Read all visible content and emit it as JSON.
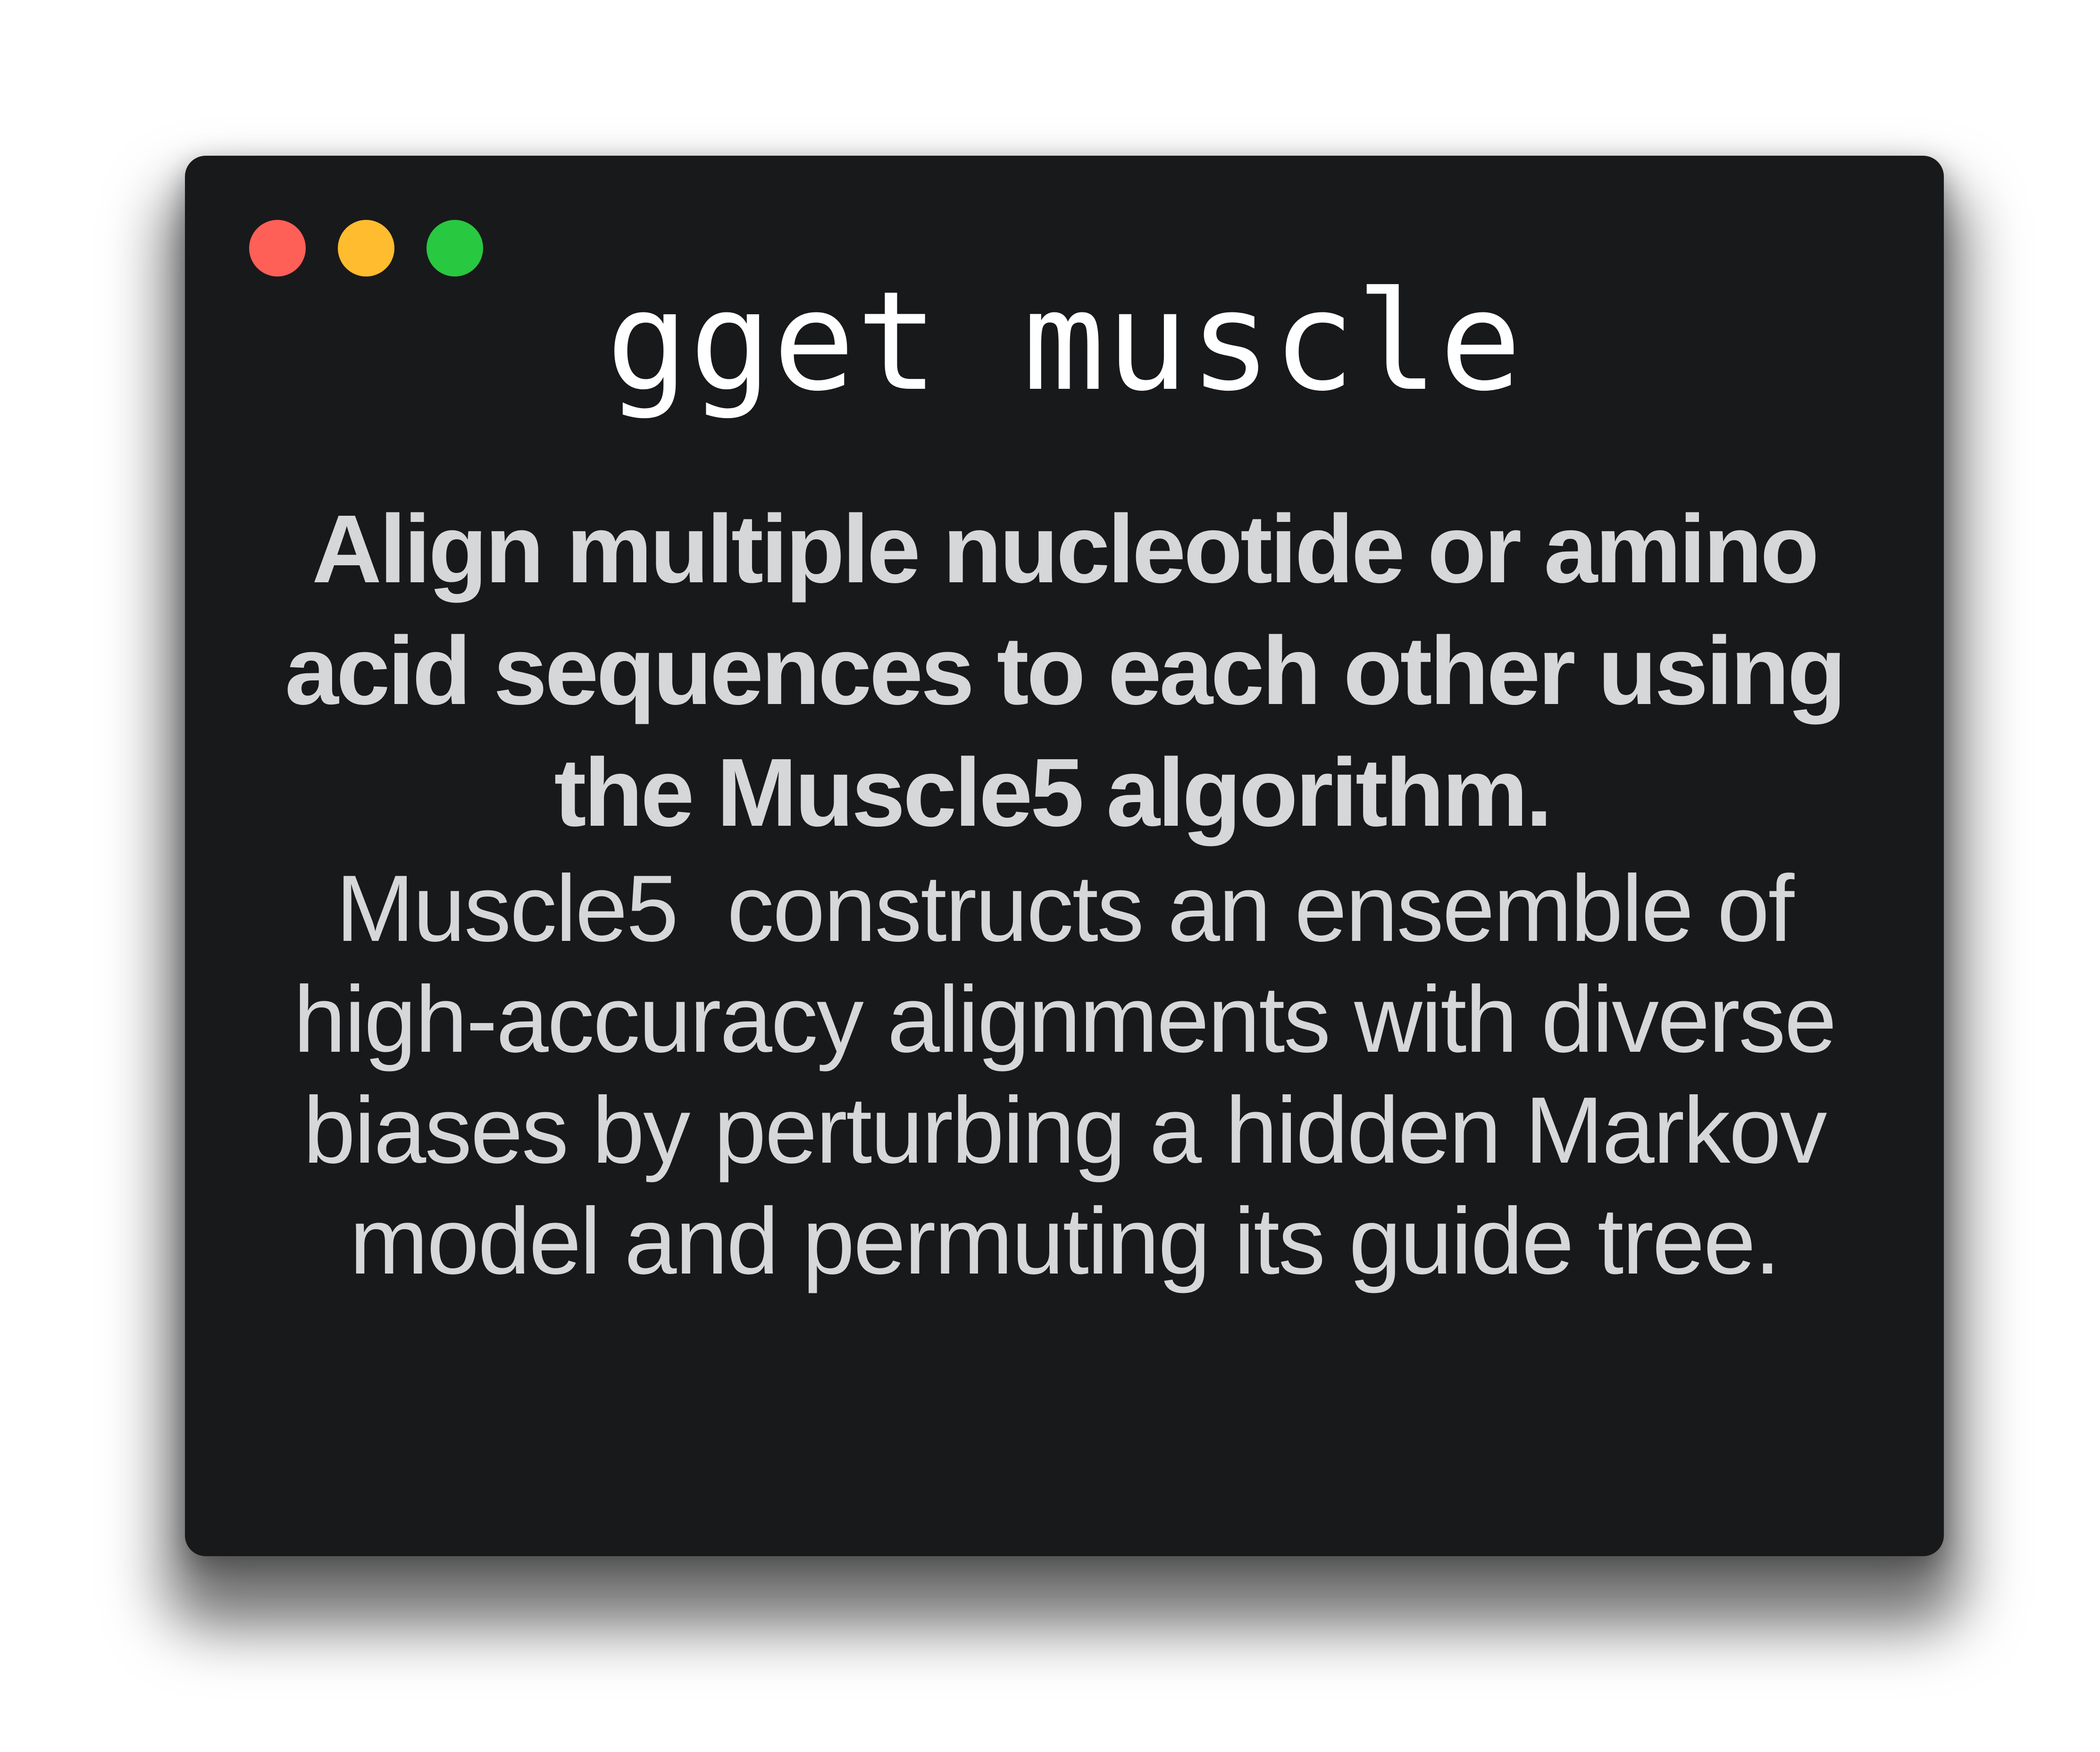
{
  "colors": {
    "window_background": "#18191b",
    "title_text": "#ffffff",
    "body_text": "#d6d7d9",
    "close": "#fe5f57",
    "minimize": "#febc2e",
    "maximize": "#28c840"
  },
  "window_controls": [
    {
      "name": "close",
      "icon": "close-dot-icon"
    },
    {
      "name": "minimize",
      "icon": "minimize-dot-icon"
    },
    {
      "name": "maximize",
      "icon": "maximize-dot-icon"
    }
  ],
  "title": "gget muscle",
  "headline": {
    "lines": [
      "Align multiple nucleotide or amino",
      "acid sequences to each other using",
      "the Muscle5 algorithm. "
    ]
  },
  "body": {
    "lines": [
      "Muscle5  constructs an ensemble of",
      "high-accuracy alignments with diverse",
      "biases by perturbing a hidden Markov",
      "model and permuting its guide tree."
    ]
  }
}
